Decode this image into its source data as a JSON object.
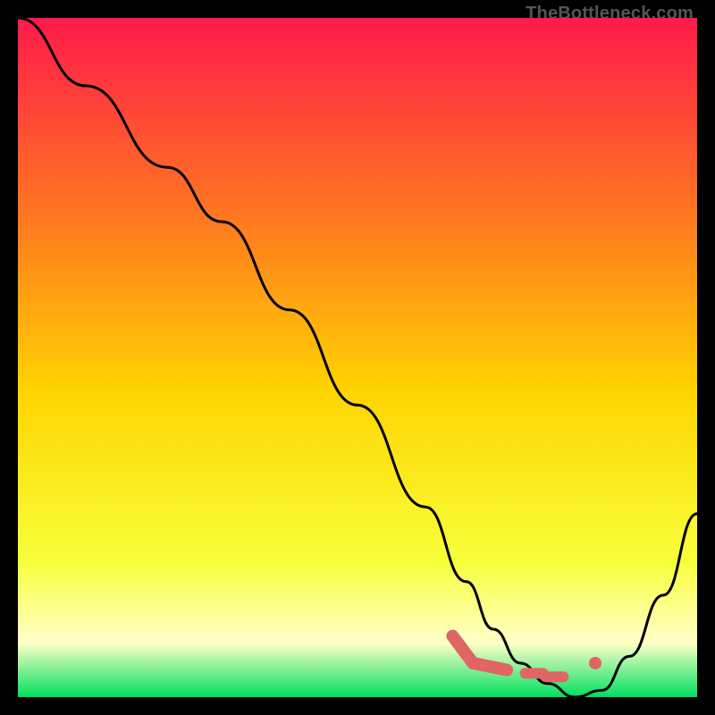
{
  "attribution": "TheBottleneck.com",
  "colors": {
    "curve": "#000000",
    "marker": "#e06666",
    "gradient_top": "#ff1a4b",
    "gradient_upper_mid": "#ff7a1f",
    "gradient_mid": "#ffd400",
    "gradient_lower_mid": "#f7ff3a",
    "gradient_pale": "#ffffc8",
    "gradient_bottom": "#00e060",
    "frame_bg": "#000000"
  },
  "chart_data": {
    "type": "line",
    "title": "",
    "xlabel": "",
    "ylabel": "",
    "xlim": [
      0,
      100
    ],
    "ylim": [
      0,
      100
    ],
    "series": [
      {
        "name": "bottleneck-curve",
        "x": [
          0,
          10,
          22,
          30,
          40,
          50,
          60,
          66,
          70,
          74,
          78,
          82,
          86,
          90,
          95,
          100
        ],
        "y": [
          100,
          90,
          78,
          70,
          57,
          43,
          28,
          17,
          10,
          5,
          2,
          0,
          1,
          6,
          15,
          27
        ]
      }
    ],
    "markers": [
      {
        "name": "low-region-start",
        "x": 64,
        "y": 9
      },
      {
        "name": "low-region-bend",
        "x": 67,
        "y": 5
      },
      {
        "name": "low-region-flat-a",
        "x": 72,
        "y": 4
      },
      {
        "name": "low-region-flat-b",
        "x": 76,
        "y": 3.5
      },
      {
        "name": "low-region-flat-c",
        "x": 79,
        "y": 3
      },
      {
        "name": "minimum-dot",
        "x": 85,
        "y": 5
      }
    ]
  }
}
